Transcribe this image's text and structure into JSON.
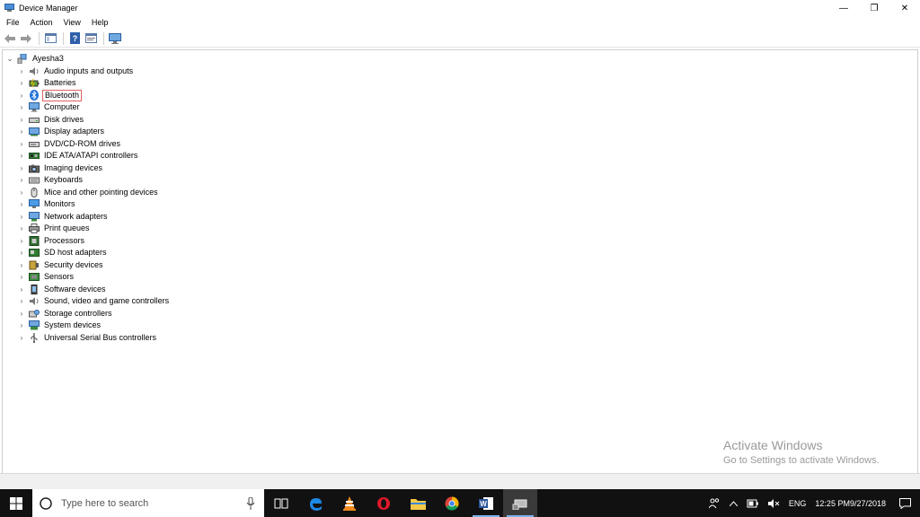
{
  "window": {
    "title": "Device Manager",
    "minimize": "—",
    "restore": "❐",
    "close": "✕"
  },
  "menu": [
    "File",
    "Action",
    "View",
    "Help"
  ],
  "tree": {
    "root": "Ayesha3",
    "items": [
      {
        "label": "Audio inputs and outputs",
        "icon": "speaker-icon"
      },
      {
        "label": "Batteries",
        "icon": "battery-icon"
      },
      {
        "label": "Bluetooth",
        "icon": "bluetooth-icon",
        "selected": true
      },
      {
        "label": "Computer",
        "icon": "computer-icon"
      },
      {
        "label": "Disk drives",
        "icon": "disk-drive-icon"
      },
      {
        "label": "Display adapters",
        "icon": "display-adapter-icon"
      },
      {
        "label": "DVD/CD-ROM drives",
        "icon": "dvd-icon"
      },
      {
        "label": "IDE ATA/ATAPI controllers",
        "icon": "ide-controller-icon"
      },
      {
        "label": "Imaging devices",
        "icon": "camera-icon"
      },
      {
        "label": "Keyboards",
        "icon": "keyboard-icon"
      },
      {
        "label": "Mice and other pointing devices",
        "icon": "mouse-icon"
      },
      {
        "label": "Monitors",
        "icon": "monitor-icon"
      },
      {
        "label": "Network adapters",
        "icon": "network-adapter-icon"
      },
      {
        "label": "Print queues",
        "icon": "printer-icon"
      },
      {
        "label": "Processors",
        "icon": "processor-icon"
      },
      {
        "label": "SD host adapters",
        "icon": "sd-card-icon"
      },
      {
        "label": "Security devices",
        "icon": "security-device-icon"
      },
      {
        "label": "Sensors",
        "icon": "sensor-icon"
      },
      {
        "label": "Software devices",
        "icon": "software-device-icon"
      },
      {
        "label": "Sound, video and game controllers",
        "icon": "sound-controller-icon"
      },
      {
        "label": "Storage controllers",
        "icon": "storage-controller-icon"
      },
      {
        "label": "System devices",
        "icon": "system-device-icon"
      },
      {
        "label": "Universal Serial Bus controllers",
        "icon": "usb-icon"
      }
    ]
  },
  "watermark": {
    "line1": "Activate Windows",
    "line2": "Go to Settings to activate Windows."
  },
  "taskbar": {
    "search_placeholder": "Type here to search",
    "tray": {
      "language": "ENG",
      "time": "12:25 PM",
      "date": "9/27/2018"
    }
  },
  "colors": {
    "selection_border": "#e06060",
    "taskbar": "#111111",
    "accent": "#7cb3ea"
  }
}
